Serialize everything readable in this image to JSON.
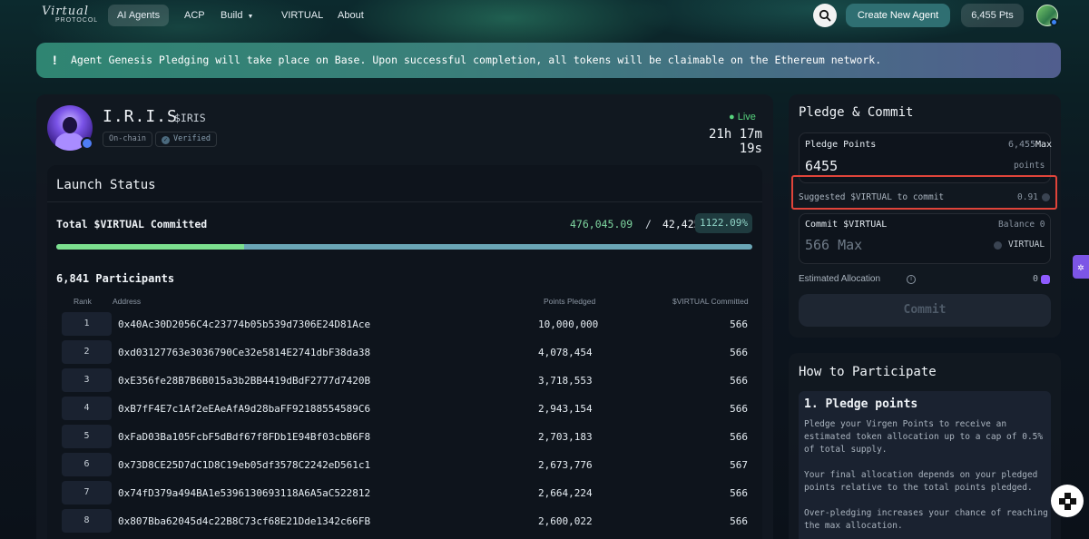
{
  "nav": {
    "logo_script": "Virtual",
    "logo_sub": "PROTOCOL",
    "links": [
      {
        "label": "AI Agents",
        "active": true
      },
      {
        "label": "ACP"
      },
      {
        "label": "Build"
      },
      {
        "label": "VIRTUAL"
      },
      {
        "label": "About"
      }
    ],
    "create_label": "Create New Agent",
    "points_label": "6,455 Pts"
  },
  "banner": {
    "icon": "!",
    "text": "Agent Genesis Pledging will take place on Base. Upon successful completion, all tokens will be claimable on the Ethereum network."
  },
  "agent": {
    "name": "I.R.I.S",
    "ticker": "$IRIS",
    "tag_onchain": "On-chain",
    "tag_verified": "Verified",
    "status": "● Live",
    "timer": "21h 17m 19s"
  },
  "launch": {
    "title": "Launch Status",
    "total_label": "Total $VIRTUAL Committed",
    "committed": "476,045.09",
    "slash": "/",
    "target": "42,425",
    "percent": "1122.09%",
    "progress_fraction": 0.27,
    "participants": "6,841 Participants",
    "headers": {
      "rank": "Rank",
      "address": "Address",
      "points": "Points Pledged",
      "virtual": "$VIRTUAL Committed"
    },
    "rows": [
      {
        "rank": "1",
        "address": "0x40Ac30D2056C4c23774b05b539d7306E24D81Ace",
        "points": "10,000,000",
        "virtual": "566"
      },
      {
        "rank": "2",
        "address": "0xd03127763e3036790Ce32e5814E2741dbF38da38",
        "points": "4,078,454",
        "virtual": "566"
      },
      {
        "rank": "3",
        "address": "0xE356fe28B7B6B015a3b2BB4419dBdF2777d7420B",
        "points": "3,718,553",
        "virtual": "566"
      },
      {
        "rank": "4",
        "address": "0xB7fF4E7c1Af2eEAeAfA9d28baFF92188554589C6",
        "points": "2,943,154",
        "virtual": "566"
      },
      {
        "rank": "5",
        "address": "0xFaD03Ba105FcbF5dBdf67f8FDb1E94Bf03cbB6F8",
        "points": "2,703,183",
        "virtual": "566"
      },
      {
        "rank": "6",
        "address": "0x73D8CE25D7dC1D8C19eb05df3578C2242eD561c1",
        "points": "2,673,776",
        "virtual": "567"
      },
      {
        "rank": "7",
        "address": "0x74fD379a494BA1e5396130693118A6A5aC522812",
        "points": "2,664,224",
        "virtual": "566"
      },
      {
        "rank": "8",
        "address": "0x807Bba62045d4c22B8C73cf68E21Dde1342c66FB",
        "points": "2,600,022",
        "virtual": "566"
      }
    ]
  },
  "pledge": {
    "title": "Pledge & Commit",
    "points_label": "Pledge Points",
    "max_value": "6,455",
    "max_label": "Max",
    "points_value": "6455",
    "points_unit": "points",
    "suggest_label": "Suggested $VIRTUAL to commit",
    "suggest_value": "0.91",
    "commit_label": "Commit $VIRTUAL",
    "balance": "Balance 0",
    "commit_placeholder": "566 Max",
    "token": "VIRTUAL",
    "est_label": "Estimated Allocation",
    "est_value": "0",
    "commit_button": "Commit"
  },
  "how": {
    "title": "How to Participate",
    "step": "1. Pledge points",
    "p1": "Pledge your Virgen Points to receive an estimated token allocation up to a cap of 0.5% of total supply.",
    "p2": "Your final allocation depends on your pledged points relative to the total points pledged.",
    "p3": "Over-pledging increases your chance of reaching the max allocation."
  },
  "colors": {
    "accent": "#2f6f72",
    "live": "#57d37d",
    "highlight": "#e0443a",
    "progress": "#7ce08f"
  }
}
